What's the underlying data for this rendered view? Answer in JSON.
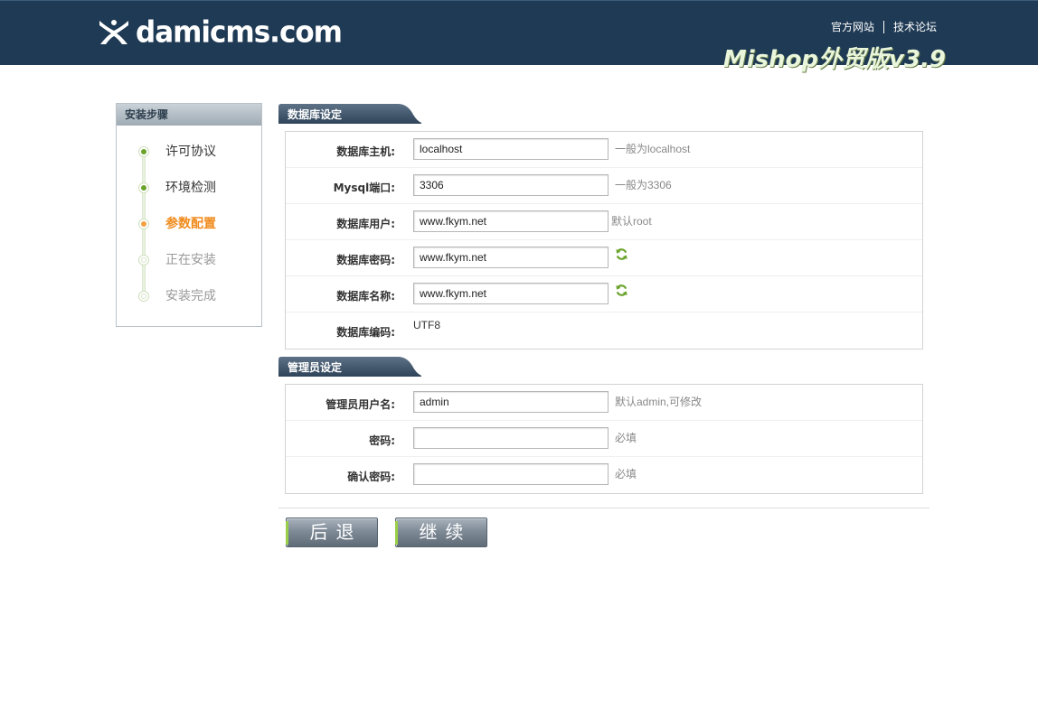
{
  "header": {
    "logo_text": "damicms.com",
    "links": [
      "官方网站",
      "技术论坛"
    ],
    "version": "Mishop外贸版v3.9"
  },
  "sidebar": {
    "title": "安装步骤",
    "steps": [
      {
        "label": "许可协议",
        "state": "done"
      },
      {
        "label": "环境检测",
        "state": "done"
      },
      {
        "label": "参数配置",
        "state": "active"
      },
      {
        "label": "正在安装",
        "state": "todo"
      },
      {
        "label": "安装完成",
        "state": "todo"
      }
    ]
  },
  "db_section": {
    "title": "数据库设定",
    "host": {
      "label": "数据库主机:",
      "value": "localhost",
      "hint": "一般为localhost"
    },
    "port": {
      "label": "Mysql端口:",
      "value": "3306",
      "hint": "一般为3306"
    },
    "user": {
      "label": "数据库用户:",
      "value": "www.fkym.net",
      "hint": "默认root"
    },
    "password": {
      "label": "数据库密码:",
      "value": "www.fkym.net",
      "icon": "refresh-icon"
    },
    "name": {
      "label": "数据库名称:",
      "value": "www.fkym.net",
      "icon": "refresh-icon"
    },
    "charset": {
      "label": "数据库编码:",
      "value": "UTF8"
    }
  },
  "admin_section": {
    "title": "管理员设定",
    "username": {
      "label": "管理员用户名:",
      "value": "admin",
      "hint": "默认admin,可修改"
    },
    "password": {
      "label": "密码:",
      "value": "",
      "hint": "必填"
    },
    "confirm": {
      "label": "确认密码:",
      "value": "",
      "hint": "必填"
    }
  },
  "buttons": {
    "back": "后退",
    "continue": "继续"
  },
  "colors": {
    "header_bg": "#1f3a54",
    "active_step": "#f08b1c",
    "done_step": "#6aa32a",
    "refresh_icon": "#6aa32a"
  }
}
